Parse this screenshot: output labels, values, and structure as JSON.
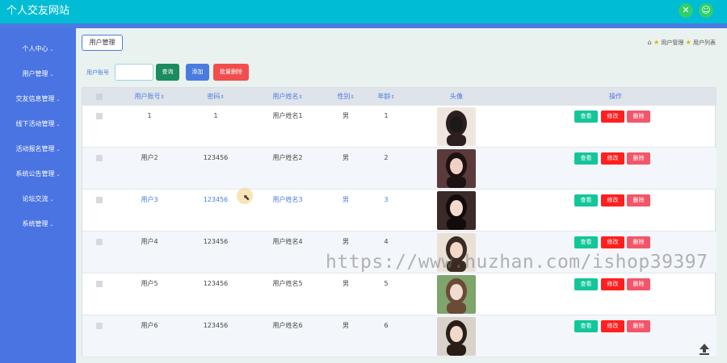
{
  "app": {
    "title": "个人交友网站"
  },
  "sidebar": {
    "items": [
      {
        "label": "个人中心"
      },
      {
        "label": "用户管理"
      },
      {
        "label": "交友信息管理"
      },
      {
        "label": "线下活动管理"
      },
      {
        "label": "活动报名管理"
      },
      {
        "label": "系统公告管理"
      },
      {
        "label": "论坛交流"
      },
      {
        "label": "系统管理"
      }
    ]
  },
  "page": {
    "tag": "用户管理",
    "breadcrumb": [
      "用户管理",
      "用户列表"
    ]
  },
  "search": {
    "label": "用户账号",
    "value": "",
    "placeholder": "",
    "query_btn": "查询",
    "add_btn": "添加",
    "batch_delete_btn": "批量删除"
  },
  "table": {
    "headers": [
      "用户账号",
      "密码",
      "用户姓名",
      "性别",
      "年龄",
      "头像",
      "操作"
    ],
    "actions": {
      "view": "查看",
      "edit": "修改",
      "delete": "删除"
    },
    "rows": [
      {
        "account": "1",
        "password": "1",
        "name": "用户姓名1",
        "gender": "男",
        "age": "1"
      },
      {
        "account": "用户2",
        "password": "123456",
        "name": "用户姓名2",
        "gender": "男",
        "age": "2"
      },
      {
        "account": "用户3",
        "password": "123456",
        "name": "用户姓名3",
        "gender": "男",
        "age": "3"
      },
      {
        "account": "用户4",
        "password": "123456",
        "name": "用户姓名4",
        "gender": "男",
        "age": "4"
      },
      {
        "account": "用户5",
        "password": "123456",
        "name": "用户姓名5",
        "gender": "男",
        "age": "5"
      },
      {
        "account": "用户6",
        "password": "123456",
        "name": "用户姓名6",
        "gender": "男",
        "age": "6"
      }
    ]
  },
  "watermark": "https://www.huzhan.com/ishop39397",
  "colors": {
    "header": "#00bcd4",
    "sidebar": "#4b74e3",
    "query": "#1c8b5e",
    "add": "#4a7be0",
    "batch_delete": "#f24d4d",
    "view": "#13c69a",
    "edit": "#ff1f1f",
    "delete": "#f2566a"
  }
}
